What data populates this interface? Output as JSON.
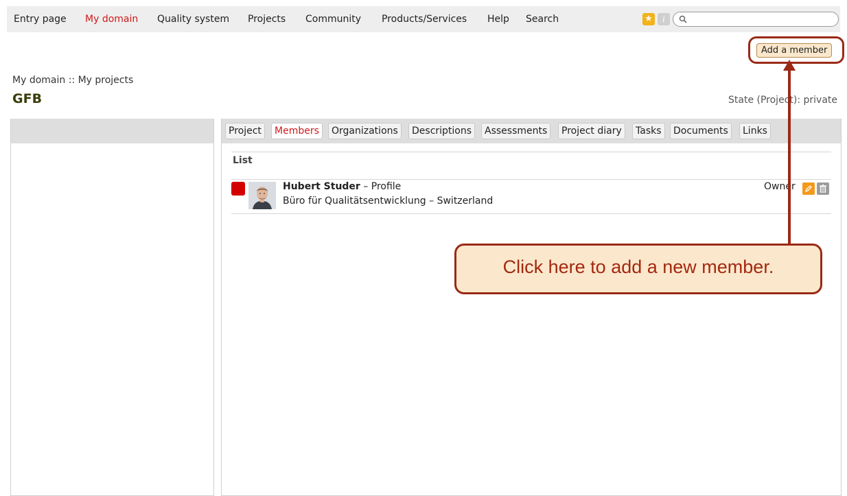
{
  "nav": {
    "items": [
      {
        "label": "Entry page",
        "active": false
      },
      {
        "label": "My domain",
        "active": true
      },
      {
        "label": "Quality system",
        "active": false
      },
      {
        "label": "Projects",
        "active": false
      },
      {
        "label": "Community",
        "active": false
      },
      {
        "label": "Products/Services",
        "active": false
      },
      {
        "label": "Help",
        "active": false
      },
      {
        "label": "Search",
        "active": false
      }
    ],
    "star_icon": "star-icon",
    "info_icon": "info-icon",
    "search_value": ""
  },
  "actions": {
    "add_member_label": "Add a member"
  },
  "breadcrumb": "My domain :: My projects",
  "project": {
    "title": "GFB",
    "state": "State (Project): private"
  },
  "tabs": [
    {
      "label": "Project",
      "active": false
    },
    {
      "label": "Members",
      "active": true
    },
    {
      "label": "Organizations",
      "active": false
    },
    {
      "label": "Descriptions",
      "active": false
    },
    {
      "label": "Assessments",
      "active": false
    },
    {
      "label": "Project diary",
      "active": false
    },
    {
      "label": "Tasks",
      "active": false
    },
    {
      "label": "Documents",
      "active": false
    },
    {
      "label": "Links",
      "active": false
    }
  ],
  "list": {
    "label": "List",
    "members": [
      {
        "name": "Hubert Studer",
        "profile_sep": " – ",
        "profile_link": "Profile",
        "organization": "Büro für Qualitätsentwicklung – Switzerland",
        "role": "Owner",
        "status_color": "#d40000"
      }
    ]
  },
  "annotation": {
    "text": "Click here to add a new member."
  },
  "colors": {
    "accent_red": "#d11919",
    "callout_border": "#9a2a16",
    "callout_fill": "#fbe8cc",
    "edit_orange": "#f39a1a"
  }
}
